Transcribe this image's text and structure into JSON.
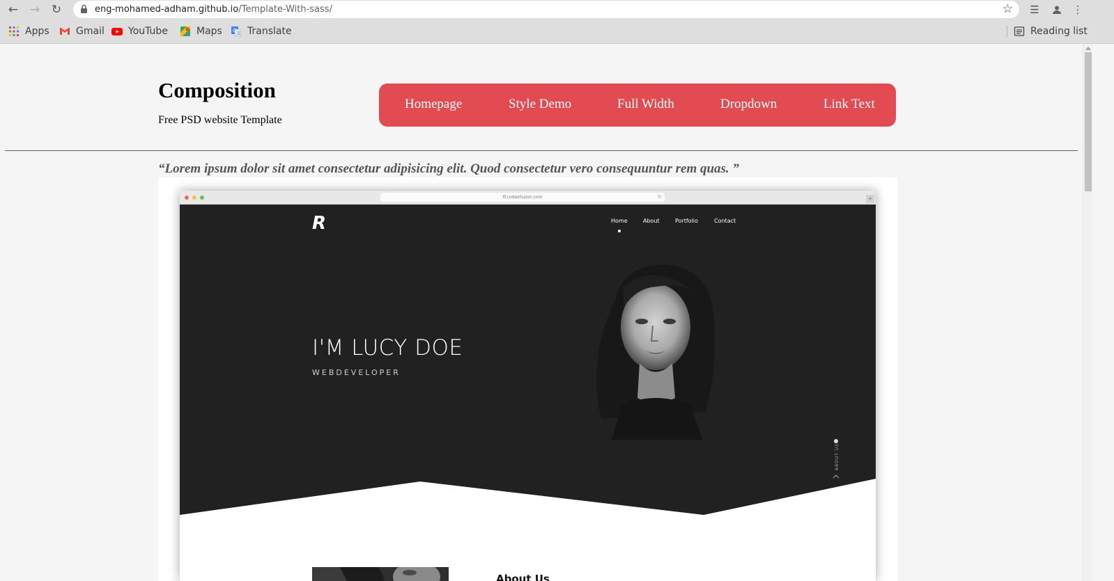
{
  "browser": {
    "url_domain": "eng-mohamed-adham.github.io",
    "url_path": "/Template-With-sass/",
    "bookmarks": [
      {
        "label": "Apps",
        "icon": "apps-grid-icon"
      },
      {
        "label": "Gmail",
        "icon": "gmail-icon"
      },
      {
        "label": "YouTube",
        "icon": "youtube-icon"
      },
      {
        "label": "Maps",
        "icon": "maps-icon"
      },
      {
        "label": "Translate",
        "icon": "translate-icon"
      }
    ],
    "reading_list": "Reading list"
  },
  "page": {
    "brand": "Composition",
    "tagline": "Free PSD website Template",
    "nav": [
      "Homepage",
      "Style Demo",
      "Full Width",
      "Dropdown",
      "Link Text"
    ],
    "quote": "“Lorem ipsum dolor sit amet consectetur adipisicing elit. Quod consectetur vero consequuntur rem quas. ”",
    "accent_color": "#e14b51"
  },
  "mockup": {
    "url": "tf.codexfusion.com",
    "logo": "R",
    "nav": [
      "Home",
      "About",
      "Portfolio",
      "Contact"
    ],
    "hero_title": "I'M LUCY DOE",
    "hero_subtitle": "WEBDEVELOPER",
    "side_label": "ABOUT US",
    "section_title": "About Us"
  }
}
